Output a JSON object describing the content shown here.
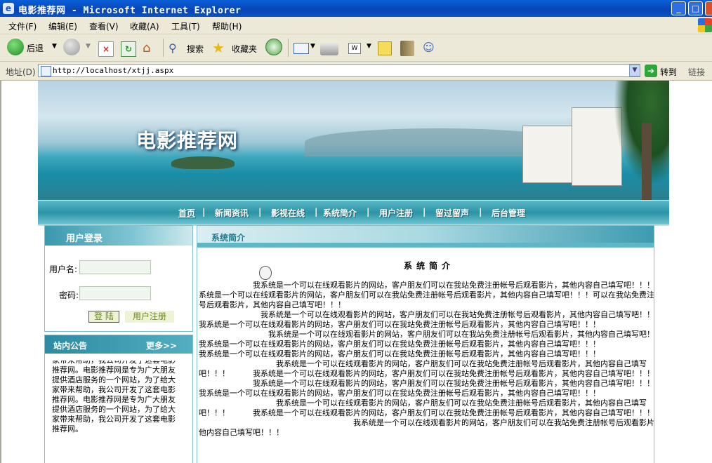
{
  "window": {
    "title": "电影推荐网 - Microsoft Internet Explorer"
  },
  "menu": [
    "文件(F)",
    "编辑(E)",
    "查看(V)",
    "收藏(A)",
    "工具(T)",
    "帮助(H)"
  ],
  "toolbar": {
    "back": "后退",
    "search": "搜索",
    "favorites": "收藏夹"
  },
  "address": {
    "label": "地址(D)",
    "url": "http://localhost/xtjj.aspx",
    "go": "转到",
    "links": "链接"
  },
  "site": {
    "banner_title": "电影推荐网",
    "nav": [
      "首页",
      "新闻资讯",
      "影视在线",
      "系统简介",
      "用户注册",
      "留过留声",
      "后台管理"
    ],
    "login": {
      "title": "用户登录",
      "username_label": "用户名:",
      "password_label": "密码:",
      "login_button": "登 陆",
      "register_button": "用户注册"
    },
    "notice": {
      "title": "站内公告",
      "more": "更多>>",
      "text": "家带来帮助，我公司开发了这套电影推荐网。电影推荐网是专为广大朋友提供酒店服务的一个网站，为了给大家带来帮助，我公司开发了这套电影推荐网。电影推荐网是专为广大朋友提供酒店服务的一个网站，为了给大家带来帮助，我公司开发了这套电影推荐网。"
    },
    "main": {
      "section_title": "系统简介",
      "heading": "系统简介",
      "paragraphs": [
        "　　　　　　　我系统是一个可以在线观看影片的网站，客户朋友们可以在我站免费注册帐号后观看影片，其他内容自己填写吧！！！我 我系统是一个可以在线观看影片的网站，客户朋友们可以在我站免费注册帐号后观看影片，其他内容自己填写吧！！！可以在我站免费注册帐号后观看影片，其他内容自己填写吧！！！",
        "　　　　　　　　我系统是一个可以在线观看影片的网站，客户朋友们可以在我站免费注册帐号后观看影片，其他内容自己填写吧！！！　我系统是一个可以在线观看影片的网站，客户朋友们可以在我站免费注册帐号后观看影片，其他内容自己填写吧！！！",
        "　　　　　　　　　我系统是一个可以在线观看影片的网站，客户朋友们可以在我站免费注册帐号后观看影片，其他内容自己填写吧！！！",
        " 我系统是一个可以在线观看影片的网站，客户朋友们可以在我站免费注册帐号后观看影片，其他内容自己填写吧！！！",
        " 我系统是一个可以在线观看影片的网站，客户朋友们可以在我站免费注册帐号后观看影片，其他内容自己填写吧！！！",
        "　　　　　　　　　　我系统是一个可以在线观看影片的网站，客户朋友们可以在我站免费注册帐号后观看影片，其他内容自己填写吧！！！　　　我系统是一个可以在线观看影片的网站，客户朋友们可以在我站免费注册帐号后观看影片，其他内容自己填写吧！！！",
        "　　　　　　　我系统是一个可以在线观看影片的网站，客户朋友们可以在我站免费注册帐号后观看影片，其他内容自己填写吧！！！",
        " 我系统是一个可以在线观看影片的网站，客户朋友们可以在我站免费注册帐号后观看影片，其他内容自己填写吧！！！",
        "　　　　　　　　　　我系统是一个可以在线观看影片的网站，客户朋友们可以在我站免费注册帐号后观看影片，其他内容自己填写吧！！！　　　我系统是一个可以在线观看影片的网站，客户朋友们可以在我站免费注册帐号后观看影片，其他内容自己填写吧！！！",
        "　　　　　　　　　　　　　　　　　　　　我系统是一个可以在线观看影片的网站，客户朋友们可以在我站免费注册帐号后观看影片，其他内容自己填写吧！！！"
      ]
    }
  },
  "colors": {
    "titlebar": "#0a53c8",
    "nav": "#2c93a6",
    "panel_border": "#7cc1cc"
  }
}
